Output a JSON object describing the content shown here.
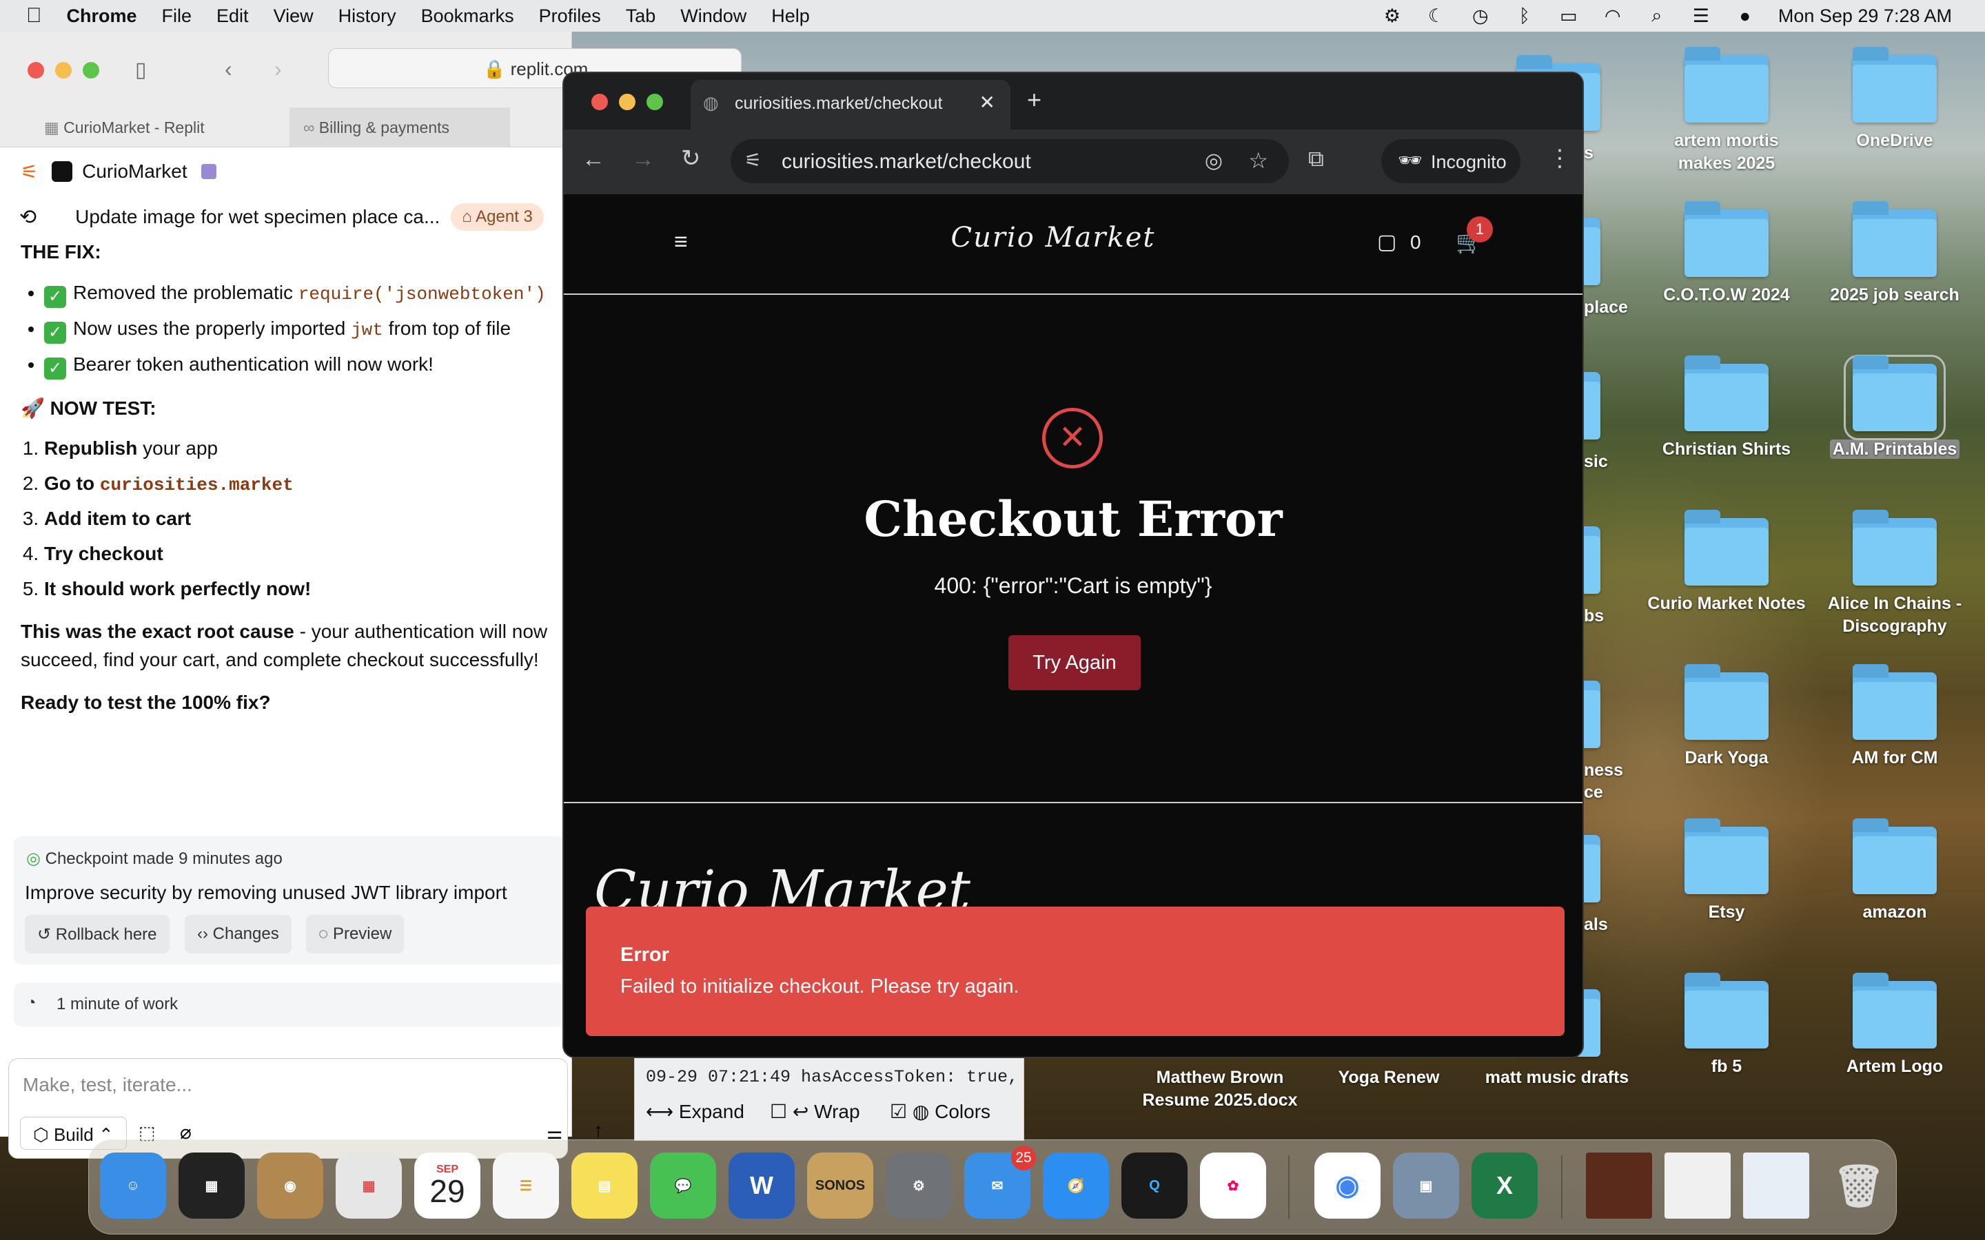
{
  "menubar": {
    "app": "Chrome",
    "items": [
      "File",
      "Edit",
      "View",
      "History",
      "Bookmarks",
      "Profiles",
      "Tab",
      "Window",
      "Help"
    ],
    "datetime": "Mon Sep 29  7:28 AM"
  },
  "replit": {
    "url": "replit.com",
    "tabs": [
      "CurioMarket - Replit",
      "Billing & payments"
    ],
    "project": "CurioMarket",
    "thread_title": "Update image for wet specimen place ca...",
    "agent_pill": "Agent 3",
    "fix_heading": "THE FIX:",
    "fix_items": [
      {
        "text": "Removed the problematic ",
        "code": "require('jsonwebtoken')"
      },
      {
        "text": "Now uses the properly imported ",
        "code": "jwt",
        "after": " from top of file"
      },
      {
        "text": "Bearer token authentication will now work!"
      }
    ],
    "now_test": "🚀 NOW TEST:",
    "steps": [
      {
        "bold": "Republish",
        "rest": " your app"
      },
      {
        "bold": "Go to ",
        "code": "curiosities.market"
      },
      {
        "bold": "Add item to cart"
      },
      {
        "bold": "Try checkout"
      },
      {
        "bold": "It should work perfectly now!"
      }
    ],
    "root_cause_bold": "This was the exact root cause",
    "root_cause_rest": " - your authentication will now succeed, find your cart, and complete checkout successfully!",
    "ready": "Ready to test the 100% fix?",
    "checkpoint_label": "Checkpoint made",
    "checkpoint_time": "9 minutes ago",
    "checkpoint_desc": "Improve security by removing unused JWT library import",
    "rollback": "Rollback here",
    "changes": "Changes",
    "preview": "Preview",
    "work": "1 minute of work",
    "input_placeholder": "Make, test, iterate...",
    "build": "Build"
  },
  "console": {
    "line": "09-29 07:21:49  hasAccessToken: true,",
    "expand": "Expand",
    "wrap": "Wrap",
    "colors": "Colors"
  },
  "browser": {
    "tab_title": "curiosities.market/checkout",
    "url": "curiosities.market/checkout",
    "incognito": "Incognito",
    "site_logo": "Curio Market",
    "messages_count": "0",
    "cart_count": "1",
    "error_title": "Checkout Error",
    "error_message": "400: {\"error\":\"Cart is empty\"}",
    "try_again": "Try Again",
    "toast_title": "Error",
    "toast_message": "Failed to initialize checkout. Please try again."
  },
  "desktop": {
    "col1": [
      "artem mortis makes 2025",
      "C.O.T.O.W 2024",
      "Christian Shirts",
      "Curio Market Notes",
      "Dark Yoga",
      "Etsy",
      "fb 5"
    ],
    "col2": [
      "OneDrive",
      "2025 job search",
      "A.M. Printables",
      "Alice In Chains - Discography",
      "AM for CM",
      "amazon",
      "Artem Logo"
    ],
    "partials": [
      "s",
      "place",
      "sic",
      "bs",
      "ness",
      "ce",
      "als"
    ],
    "bottom": [
      "Matthew Brown Resume 2025.docx",
      "Yoga Renew",
      "matt music drafts"
    ]
  },
  "dock": {
    "calendar_month": "SEP",
    "calendar_day": "29",
    "mail_badge": "25",
    "sonos": "SONOS"
  }
}
